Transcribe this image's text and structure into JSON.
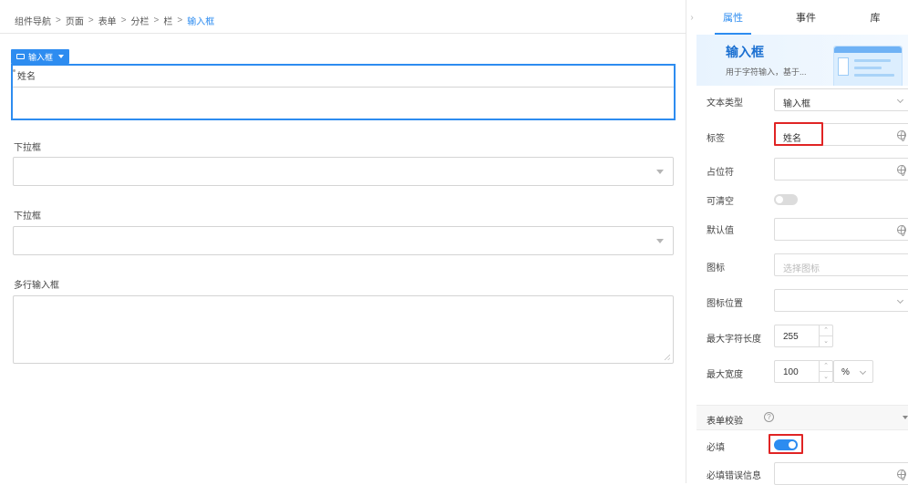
{
  "breadcrumb": {
    "items": [
      "组件导航",
      "页面",
      "表单",
      "分栏",
      "栏"
    ],
    "current": "输入框",
    "separator": ">"
  },
  "canvas": {
    "selected_tag": "输入框",
    "field1_label": "姓名",
    "field2_label": "下拉框",
    "field3_label": "下拉框",
    "field4_label": "多行输入框"
  },
  "panel": {
    "collapse_glyph": "›",
    "tabs": [
      "属性",
      "事件",
      "库"
    ],
    "active_tab": "属性",
    "hero": {
      "title": "输入框",
      "desc": "用于字符输入，基于..."
    },
    "props": {
      "text_type_label": "文本类型",
      "text_type_value": "输入框",
      "label_label": "标签",
      "label_value": "姓名",
      "placeholder_label": "占位符",
      "clearable_label": "可清空",
      "clearable": false,
      "default_label": "默认值",
      "icon_label": "图标",
      "icon_placeholder": "选择图标",
      "icon_pos_label": "图标位置",
      "maxlen_label": "最大字符长度",
      "maxlen_value": "255",
      "maxwidth_label": "最大宽度",
      "maxwidth_value": "100",
      "maxwidth_unit": "%"
    },
    "validation": {
      "title": "表单校验",
      "help": "?",
      "required_label": "必填",
      "required": true,
      "required_msg_label": "必填错误信息"
    }
  },
  "colors": {
    "accent": "#2d8cf0",
    "highlight": "#e02424",
    "switch_on": "#2d8cf0",
    "switch_off": "#dcdcdc"
  }
}
